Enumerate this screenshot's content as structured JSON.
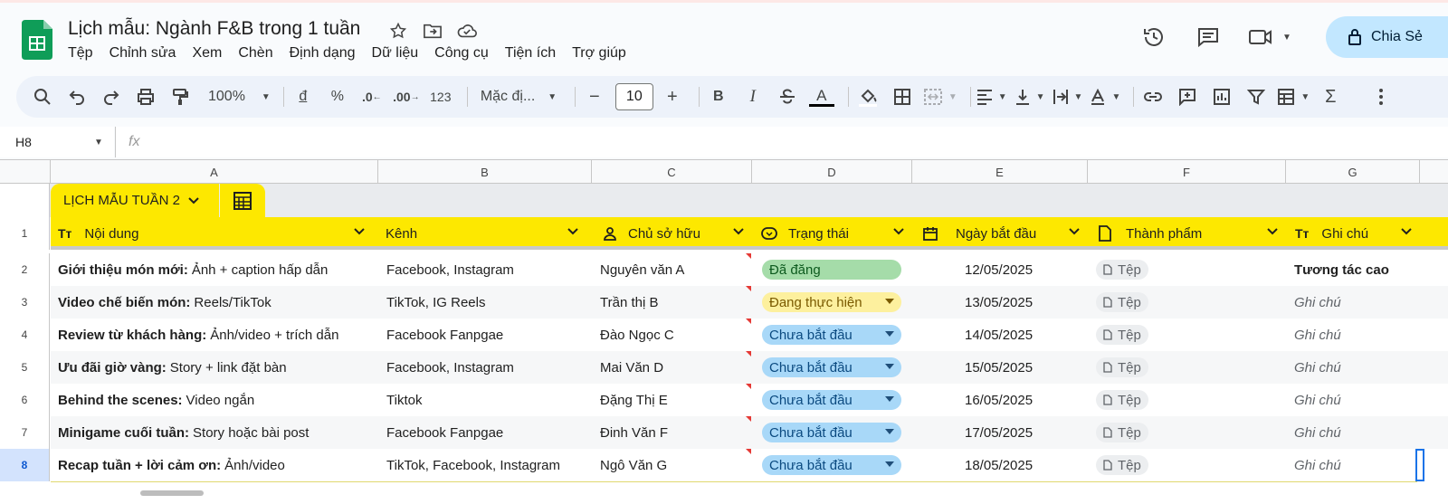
{
  "app": {
    "title": "Lịch mẫu: Ngành F&B trong 1 tuần",
    "brand_color": "#0f9d58"
  },
  "menu": [
    "Tệp",
    "Chỉnh sửa",
    "Xem",
    "Chèn",
    "Định dạng",
    "Dữ liệu",
    "Công cụ",
    "Tiện ích",
    "Trợ giúp"
  ],
  "share_label": "Chia Sẻ",
  "toolbar": {
    "zoom": "100%",
    "currency": "đ",
    "percent": "%",
    "dec_less": ".0",
    "dec_more": ".00",
    "number_format": "123",
    "font": "Mặc đị...",
    "font_size": "10",
    "bold": "B",
    "italic": "I",
    "text_color": "A"
  },
  "name_box": "H8",
  "formula_icon": "fx",
  "columns": [
    "A",
    "B",
    "C",
    "D",
    "E",
    "F",
    "G"
  ],
  "table": {
    "name": "LỊCH MẪU TUẦN 2",
    "headers": [
      "Nội dung",
      "Kênh",
      "Chủ sở hữu",
      "Trạng thái",
      "Ngày bắt đầu",
      "Thành phẩm",
      "Ghi chú"
    ],
    "rows": [
      {
        "num": "2",
        "title": "Giới thiệu món mới:",
        "desc": "Ảnh + caption hấp dẫn",
        "channel": "Facebook, Instagram",
        "owner": "Nguyên văn A",
        "status": "Đã đăng",
        "date": "12/05/2025",
        "file": "Tệp",
        "note": "Tương tác cao"
      },
      {
        "num": "3",
        "title": "Video chế biến món:",
        "desc": "Reels/TikTok",
        "channel": "TikTok, IG Reels",
        "owner": "Trần thị B",
        "status": "Đang thực hiện",
        "date": "13/05/2025",
        "file": "Tệp",
        "note": "Ghi chú"
      },
      {
        "num": "4",
        "title": "Review từ khách hàng:",
        "desc": "Ảnh/video + trích dẫn",
        "channel": "Facebook Fanpgae",
        "owner": "Đào Ngọc C",
        "status": "Chưa bắt đầu",
        "date": "14/05/2025",
        "file": "Tệp",
        "note": "Ghi chú"
      },
      {
        "num": "5",
        "title": "Ưu đãi giờ vàng:",
        "desc": "Story + link đặt bàn",
        "channel": "Facebook, Instagram",
        "owner": "Mai Văn D",
        "status": "Chưa bắt đầu",
        "date": "15/05/2025",
        "file": "Tệp",
        "note": "Ghi chú"
      },
      {
        "num": "6",
        "title": "Behind the scenes:",
        "desc": "Video ngắn",
        "channel": "Tiktok",
        "owner": "Đặng Thị E",
        "status": "Chưa bắt đầu",
        "date": "16/05/2025",
        "file": "Tệp",
        "note": "Ghi chú"
      },
      {
        "num": "7",
        "title": "Minigame cuối tuần:",
        "desc": "Story hoặc bài post",
        "channel": "Facebook Fanpgae",
        "owner": "Đinh Văn F",
        "status": "Chưa bắt đầu",
        "date": "17/05/2025",
        "file": "Tệp",
        "note": "Ghi chú"
      },
      {
        "num": "8",
        "title": "Recap tuần + lời cảm ơn:",
        "desc": "Ảnh/video",
        "channel": "TikTok, Facebook, Instagram",
        "owner": "Ngô Văn G",
        "status": "Chưa bắt đầu",
        "date": "18/05/2025",
        "file": "Tệp",
        "note": "Ghi chú"
      }
    ]
  },
  "status_colors": {
    "Đã đăng": "#a5dca9",
    "Đang thực hiện": "#fdf09e",
    "Chưa bắt đầu": "#a8d8f8"
  },
  "header_color": "#fde800"
}
